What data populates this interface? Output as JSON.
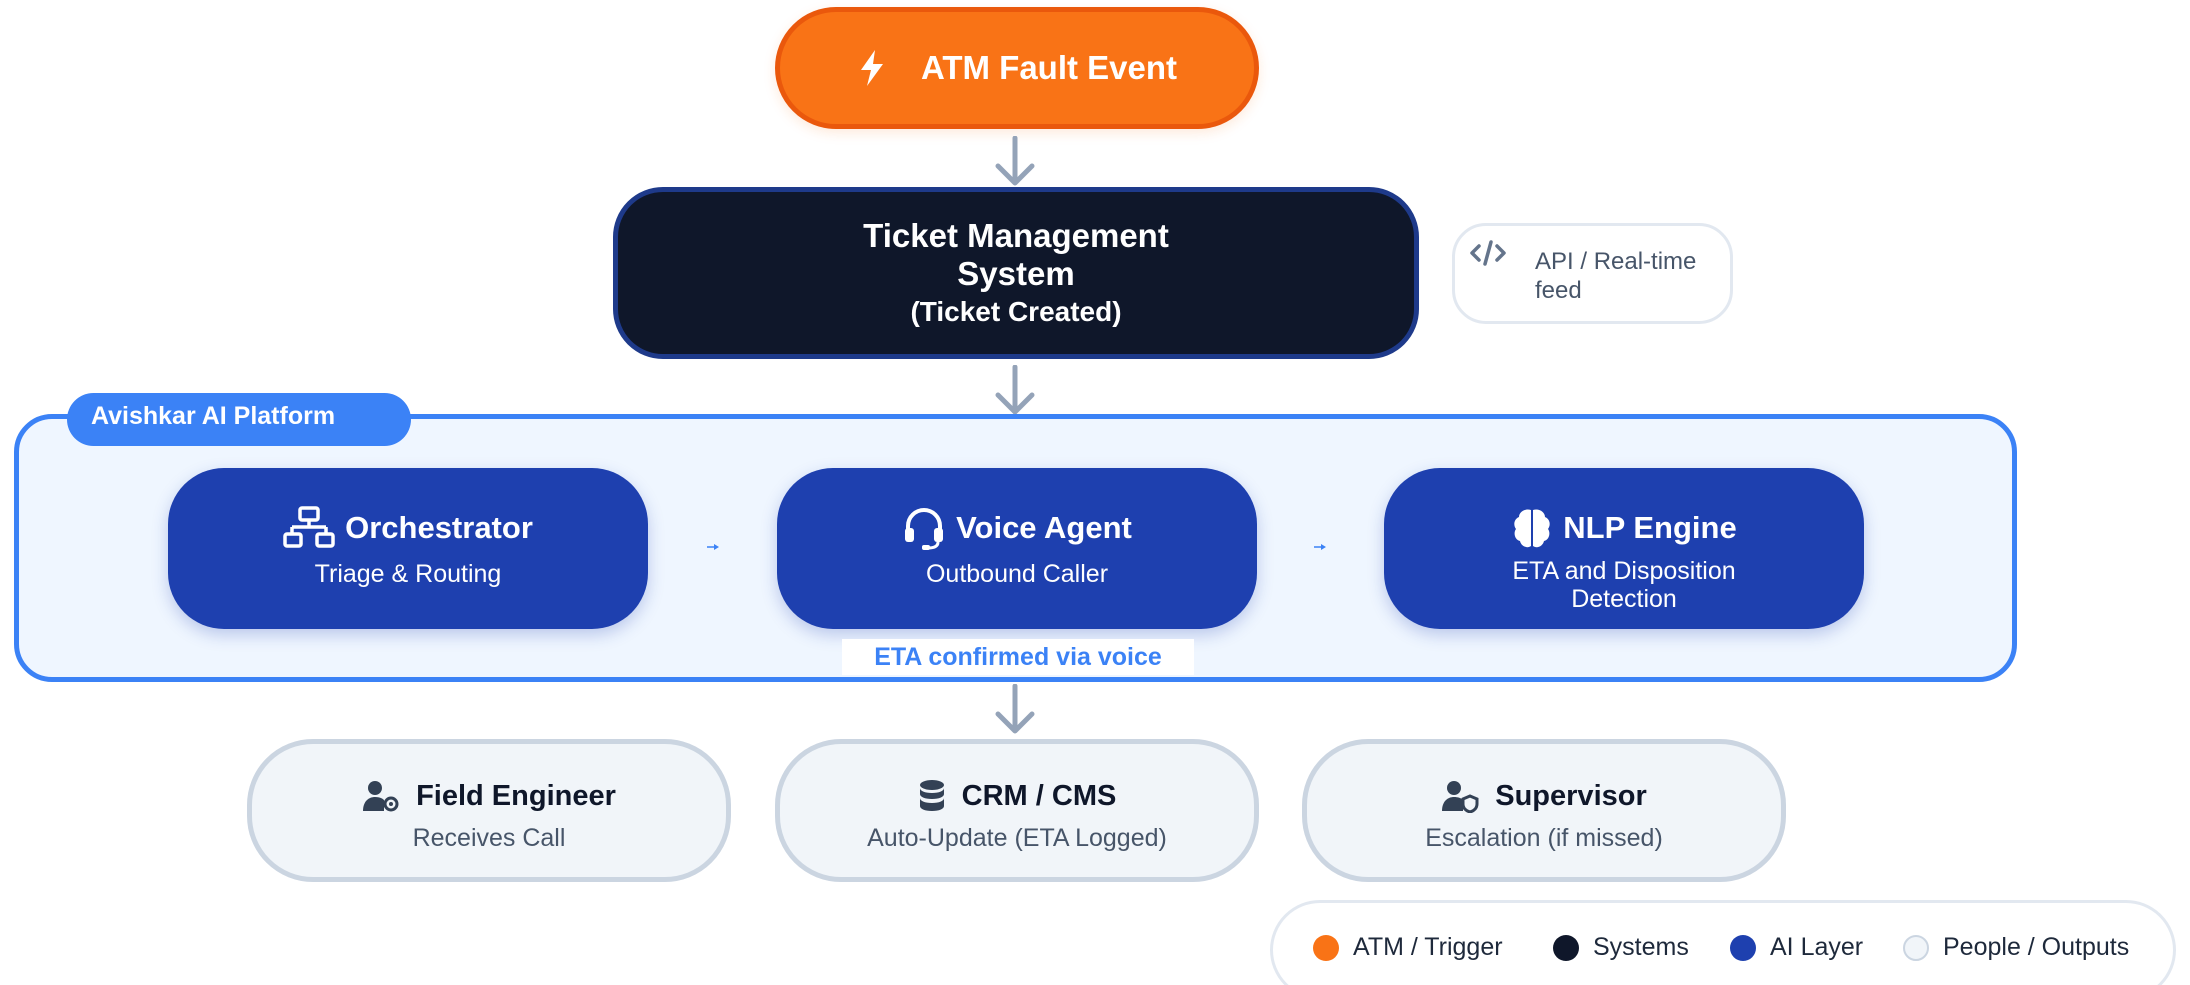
{
  "trigger": {
    "label": "ATM Fault Event",
    "icon": "lightning-bolt-icon",
    "color": "#f97316"
  },
  "ticket_system": {
    "line1": "Ticket Management",
    "line2": "System",
    "line3": "(Ticket Created)",
    "color": "#0f172a"
  },
  "api_note": {
    "icon": "code-icon",
    "text": "API / Real-time feed"
  },
  "platform": {
    "tag": "Avishkar AI Platform",
    "nodes": [
      {
        "icon": "network-icon",
        "title": "Orchestrator",
        "subtitle": "Triage & Routing"
      },
      {
        "icon": "headset-icon",
        "title": "Voice Agent",
        "subtitle": "Outbound Caller"
      },
      {
        "icon": "brain-icon",
        "title": "NLP Engine",
        "subtitle_line1": "ETA and Disposition",
        "subtitle_line2": "Detection"
      }
    ],
    "eta_label": "ETA confirmed via voice",
    "color": "#1e40af",
    "accent": "#3b82f6"
  },
  "outputs": [
    {
      "icon": "user-gear-icon",
      "title": "Field Engineer",
      "subtitle": "Receives Call"
    },
    {
      "icon": "database-icon",
      "title": "CRM / CMS",
      "subtitle": "Auto-Update (ETA Logged)"
    },
    {
      "icon": "user-shield-icon",
      "title": "Supervisor",
      "subtitle": "Escalation (if missed)"
    }
  ],
  "legend": [
    {
      "label": "ATM / Trigger",
      "color": "#f97316"
    },
    {
      "label": "Systems",
      "color": "#0f172a"
    },
    {
      "label": "AI Layer",
      "color": "#1e40af"
    },
    {
      "label": "People / Outputs",
      "color": "#f1f5f9"
    }
  ]
}
